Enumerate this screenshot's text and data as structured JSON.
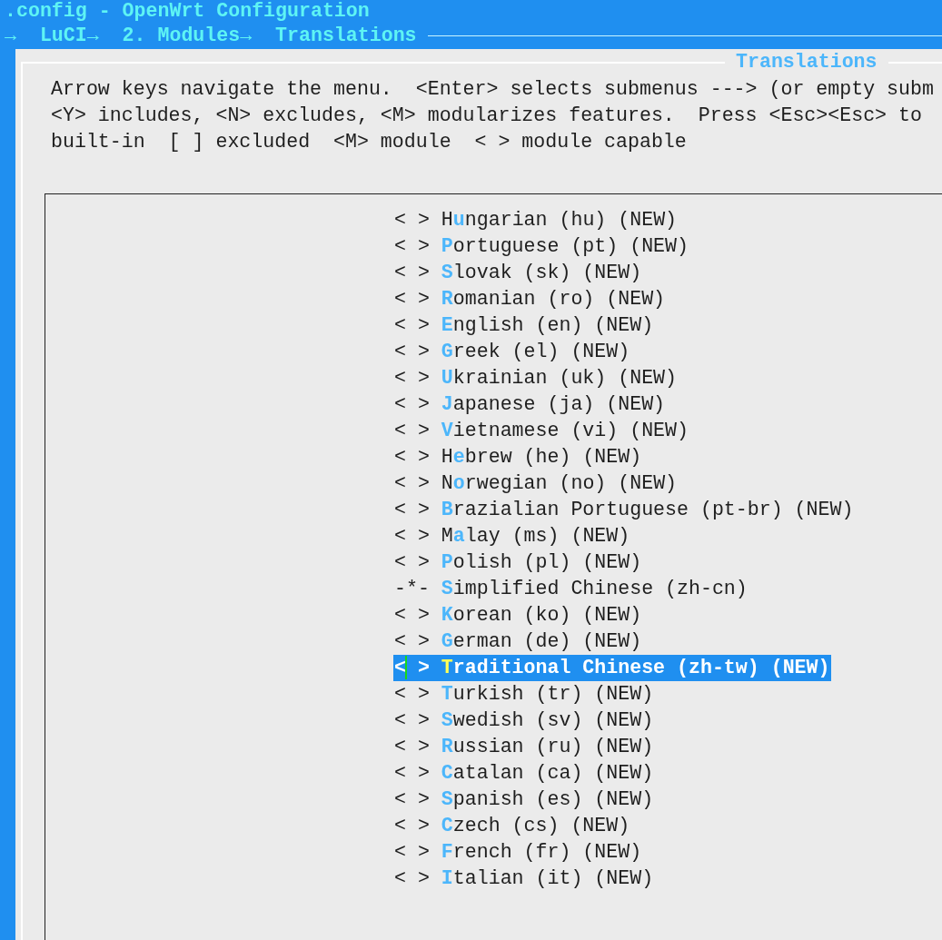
{
  "header": {
    "title": ".config - OpenWrt Configuration",
    "breadcrumb": "→  LuCI→  2. Modules→  Translations"
  },
  "dialog": {
    "title": "Translations",
    "help_lines": [
      "Arrow keys navigate the menu.  <Enter> selects submenus ---> (or empty subm",
      "<Y> includes, <N> excludes, <M> modularizes features.  Press <Esc><Esc> to",
      "built-in  [ ] excluded  <M> module  < > module capable"
    ],
    "menu": {
      "items": [
        {
          "marker": "< >",
          "before": "H",
          "hotkey": "u",
          "after": "ngarian (hu) (NEW)",
          "selected": false
        },
        {
          "marker": "< >",
          "hotkey": "P",
          "after": "ortuguese (pt) (NEW)",
          "selected": false
        },
        {
          "marker": "< >",
          "hotkey": "S",
          "after": "lovak (sk) (NEW)",
          "selected": false
        },
        {
          "marker": "< >",
          "hotkey": "R",
          "after": "omanian (ro) (NEW)",
          "selected": false
        },
        {
          "marker": "< >",
          "hotkey": "E",
          "after": "nglish (en) (NEW)",
          "selected": false
        },
        {
          "marker": "< >",
          "hotkey": "G",
          "after": "reek (el) (NEW)",
          "selected": false
        },
        {
          "marker": "< >",
          "hotkey": "U",
          "after": "krainian (uk) (NEW)",
          "selected": false
        },
        {
          "marker": "< >",
          "hotkey": "J",
          "after": "apanese (ja) (NEW)",
          "selected": false
        },
        {
          "marker": "< >",
          "hotkey": "V",
          "after": "ietnamese (vi) (NEW)",
          "selected": false
        },
        {
          "marker": "< >",
          "before": "H",
          "hotkey": "e",
          "after": "brew (he) (NEW)",
          "selected": false
        },
        {
          "marker": "< >",
          "before": "N",
          "hotkey": "o",
          "after": "rwegian (no) (NEW)",
          "selected": false
        },
        {
          "marker": "< >",
          "hotkey": "B",
          "after": "razialian Portuguese (pt-br) (NEW)",
          "selected": false
        },
        {
          "marker": "< >",
          "before": "M",
          "hotkey": "a",
          "after": "lay (ms) (NEW)",
          "selected": false
        },
        {
          "marker": "< >",
          "hotkey": "P",
          "after": "olish (pl) (NEW)",
          "selected": false
        },
        {
          "marker": "-*-",
          "hotkey": "S",
          "after": "implified Chinese (zh-cn)",
          "selected": false
        },
        {
          "marker": "< >",
          "hotkey": "K",
          "after": "orean (ko) (NEW)",
          "selected": false
        },
        {
          "marker": "< >",
          "hotkey": "G",
          "after": "erman (de) (NEW)",
          "selected": false
        },
        {
          "marker": "< >",
          "hotkey": "T",
          "after": "raditional Chinese (zh-tw) (NEW)",
          "selected": true
        },
        {
          "marker": "< >",
          "hotkey": "T",
          "after": "urkish (tr) (NEW)",
          "selected": false
        },
        {
          "marker": "< >",
          "hotkey": "S",
          "after": "wedish (sv) (NEW)",
          "selected": false
        },
        {
          "marker": "< >",
          "hotkey": "R",
          "after": "ussian (ru) (NEW)",
          "selected": false
        },
        {
          "marker": "< >",
          "hotkey": "C",
          "after": "atalan (ca) (NEW)",
          "selected": false
        },
        {
          "marker": "< >",
          "hotkey": "S",
          "after": "panish (es) (NEW)",
          "selected": false
        },
        {
          "marker": "< >",
          "hotkey": "C",
          "after": "zech (cs) (NEW)",
          "selected": false
        },
        {
          "marker": "< >",
          "hotkey": "F",
          "after": "rench (fr) (NEW)",
          "selected": false
        },
        {
          "marker": "< >",
          "hotkey": "I",
          "after": "talian (it) (NEW)",
          "selected": false
        }
      ]
    }
  }
}
